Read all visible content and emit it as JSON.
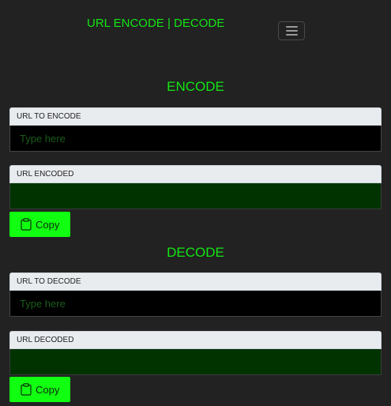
{
  "navbar": {
    "brand": "URL ENCODE | DECODE",
    "toggler_icon": "menu-icon"
  },
  "encode": {
    "title": "ENCODE",
    "input_label": "URL TO ENCODE",
    "input_placeholder": "Type here",
    "input_value": "",
    "output_label": "URL ENCODED",
    "output_value": "",
    "copy_label": "Copy",
    "copy_icon": "clipboard-icon"
  },
  "decode": {
    "title": "DECODE",
    "input_label": "URL TO DECODE",
    "input_placeholder": "Type here",
    "input_value": "",
    "output_label": "URL DECODED",
    "output_value": "",
    "copy_label": "Copy",
    "copy_icon": "clipboard-icon"
  },
  "colors": {
    "background": "#222222",
    "accent": "#14e614",
    "button": "#11ff11",
    "output_bg": "#003300"
  }
}
